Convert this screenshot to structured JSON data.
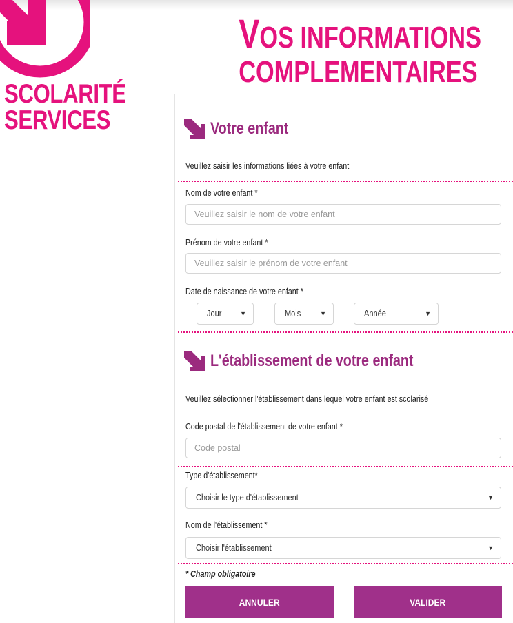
{
  "brand": {
    "line1": "SCOLARITÉ",
    "line2": "SERVICES",
    "color": "#e5127d"
  },
  "page_title": {
    "line1_initial": "V",
    "line1_rest": "OS INFORMATIONS",
    "line2": "COMPLEMENTAIRES"
  },
  "section_child": {
    "title": "Votre enfant",
    "description": "Veuillez saisir les informations liées à votre enfant",
    "name_label": "Nom de votre enfant *",
    "name_placeholder": "Veuillez saisir le nom de votre enfant",
    "firstname_label": "Prénom de votre enfant *",
    "firstname_placeholder": "Veuillez saisir le prénom de votre enfant",
    "birthdate_label": "Date de naissance de votre enfant *",
    "day_value": "Jour",
    "month_value": "Mois",
    "year_value": "Année"
  },
  "section_school": {
    "title": "L'établissement de votre enfant",
    "description": "Veuillez sélectionner l'établissement dans lequel votre enfant est scolarisé",
    "postal_label": "Code postal de l'établissement de votre enfant *",
    "postal_placeholder": "Code postal",
    "type_label": "Type d'établissement*",
    "type_value": "Choisir le type d'établissement",
    "school_label": "Nom de l'établissement *",
    "school_value": "Choisir l'établissement"
  },
  "required_note": "* Champ obligatoire",
  "buttons": {
    "cancel": "ANNULER",
    "validate": "VALIDER",
    "color": "#a0308a"
  },
  "colors": {
    "accent_pink": "#e5127d",
    "section_purple": "#9b2a7e"
  }
}
